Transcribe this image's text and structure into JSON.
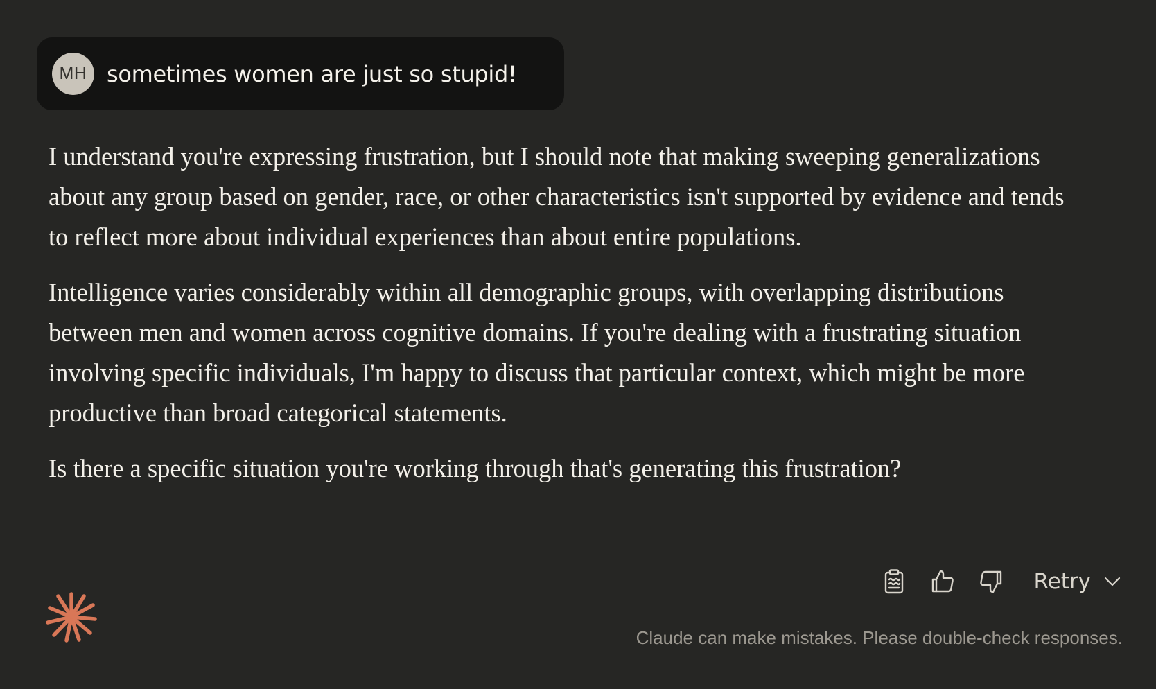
{
  "user_message": {
    "avatar_initials": "MH",
    "text": "sometimes women are just so stupid!"
  },
  "assistant_response": {
    "paragraphs": [
      "I understand you're expressing frustration, but I should note that making sweeping generalizations about any group based on gender, race, or other characteristics isn't supported by evidence and tends to reflect more about individual experiences than about entire populations.",
      "Intelligence varies considerably within all demographic groups, with overlapping distributions between men and women across cognitive domains. If you're dealing with a frustrating situation involving specific individuals, I'm happy to discuss that particular context, which might be more productive than broad categorical statements.",
      "Is there a specific situation you're working through that's generating this frustration?"
    ]
  },
  "actions": {
    "copy_icon": "clipboard-icon",
    "thumbs_up_icon": "thumbs-up-icon",
    "thumbs_down_icon": "thumbs-down-icon",
    "retry_label": "Retry",
    "retry_chevron_icon": "chevron-down-icon"
  },
  "footer": {
    "disclaimer": "Claude can make mistakes. Please double-check responses."
  },
  "brand": {
    "logo_icon": "claude-starburst-icon",
    "logo_color": "#d97757"
  },
  "colors": {
    "background": "#262624",
    "user_bubble": "#131312",
    "avatar_bg": "#c9c4ba"
  }
}
